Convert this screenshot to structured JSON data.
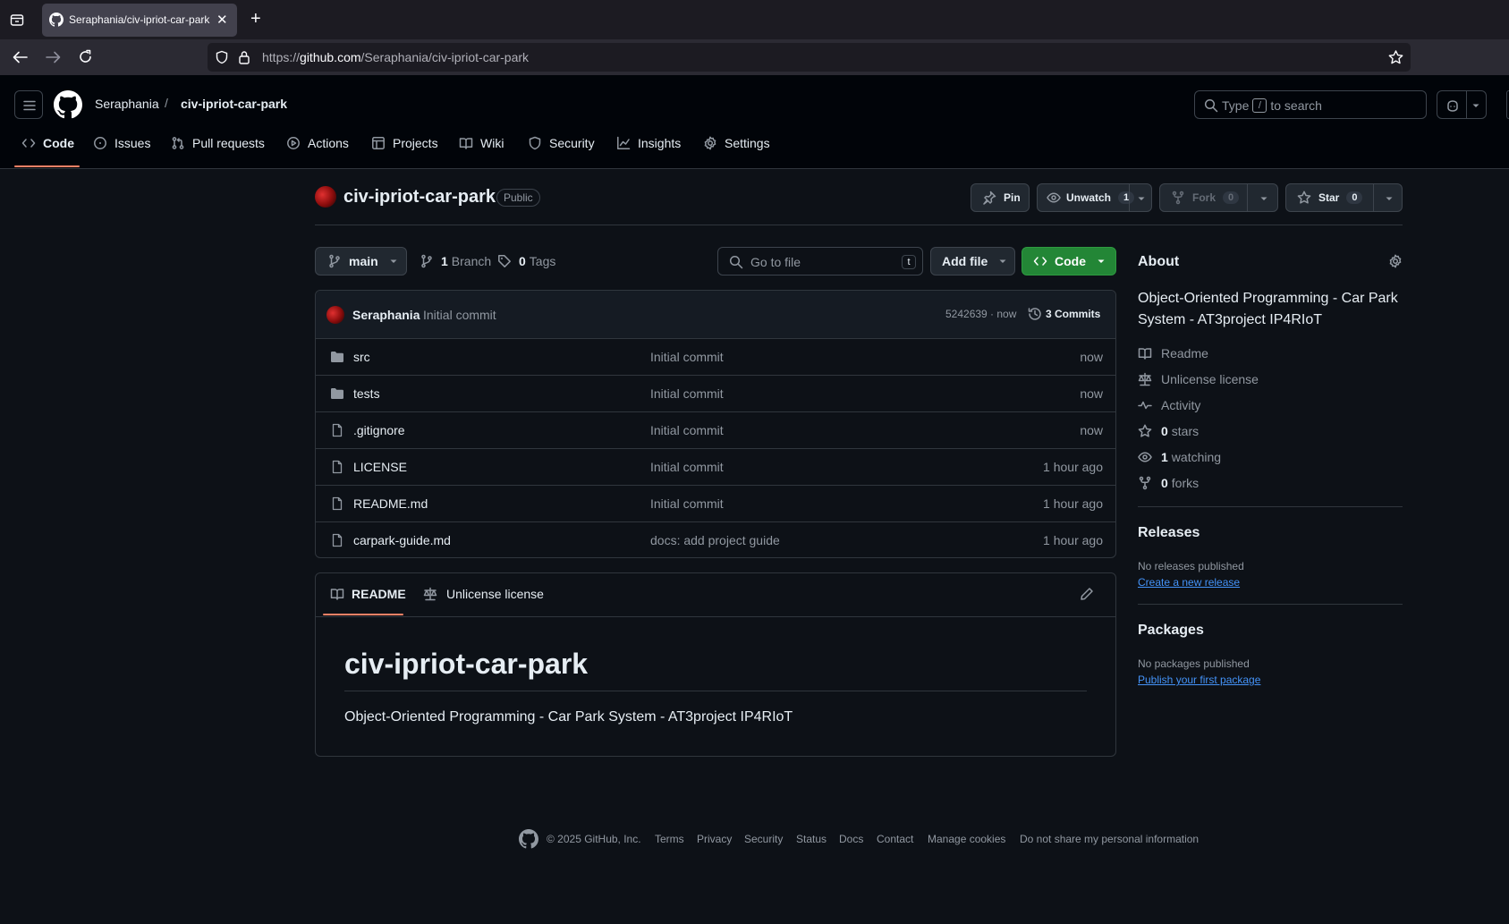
{
  "browser": {
    "tab_title": "Seraphania/civ-ipriot-car-park: O",
    "url_prefix": "https://",
    "url_domain": "github.com",
    "url_path": "/Seraphania/civ-ipriot-car-park"
  },
  "header": {
    "owner": "Seraphania",
    "separator": "/",
    "repo": "civ-ipriot-car-park",
    "search_prefix": "Type",
    "search_key": "/",
    "search_suffix": "to search"
  },
  "repo_nav": {
    "code": "Code",
    "issues": "Issues",
    "pulls": "Pull requests",
    "actions": "Actions",
    "projects": "Projects",
    "wiki": "Wiki",
    "security": "Security",
    "insights": "Insights",
    "settings": "Settings"
  },
  "repo": {
    "name": "civ-ipriot-car-park",
    "visibility": "Public",
    "pin": "Pin",
    "unwatch": "Unwatch",
    "watch_count": "1",
    "fork": "Fork",
    "fork_count": "0",
    "star": "Star",
    "star_count": "0"
  },
  "toolbar": {
    "branch": "main",
    "branch_count": "1",
    "branch_label": "Branch",
    "tag_count": "0",
    "tag_label": "Tags",
    "goto_placeholder": "Go to file",
    "goto_key": "t",
    "add_file": "Add file",
    "code": "Code"
  },
  "commit": {
    "author": "Seraphania",
    "message": "Initial commit",
    "hash_time": "5242639 · now",
    "commits": "3 Commits"
  },
  "files": [
    {
      "type": "dir",
      "name": "src",
      "message": "Initial commit",
      "time": "now"
    },
    {
      "type": "dir",
      "name": "tests",
      "message": "Initial commit",
      "time": "now"
    },
    {
      "type": "file",
      "name": ".gitignore",
      "message": "Initial commit",
      "time": "now"
    },
    {
      "type": "file",
      "name": "LICENSE",
      "message": "Initial commit",
      "time": "1 hour ago"
    },
    {
      "type": "file",
      "name": "README.md",
      "message": "Initial commit",
      "time": "1 hour ago"
    },
    {
      "type": "file",
      "name": "carpark-guide.md",
      "message": "docs: add project guide",
      "time": "1 hour ago"
    }
  ],
  "readme": {
    "tab_readme": "README",
    "tab_license": "Unlicense license",
    "heading": "civ-ipriot-car-park",
    "body": "Object-Oriented Programming - Car Park System - AT3project IP4RIoT"
  },
  "about": {
    "title": "About",
    "description": "Object-Oriented Programming - Car Park System - AT3project IP4RIoT",
    "readme": "Readme",
    "license": "Unlicense license",
    "activity": "Activity",
    "stars_count": "0",
    "stars_label": "stars",
    "watching_count": "1",
    "watching_label": "watching",
    "forks_count": "0",
    "forks_label": "forks",
    "releases_title": "Releases",
    "releases_none": "No releases published",
    "releases_link": "Create a new release",
    "packages_title": "Packages",
    "packages_none": "No packages published",
    "packages_link": "Publish your first package"
  },
  "footer": {
    "copyright": "© 2025 GitHub, Inc.",
    "terms": "Terms",
    "privacy": "Privacy",
    "security": "Security",
    "status": "Status",
    "docs": "Docs",
    "contact": "Contact",
    "cookies": "Manage cookies",
    "donotshare": "Do not share my personal information"
  },
  "colors": {
    "accent_green": "#238636",
    "link_blue": "#4493f8",
    "tab_underline": "#f78166",
    "bg": "#0d1117"
  }
}
